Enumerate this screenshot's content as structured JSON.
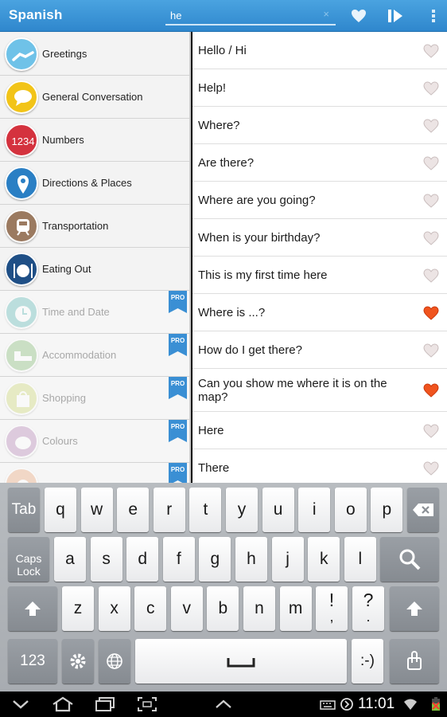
{
  "app": {
    "title": "Spanish"
  },
  "search": {
    "value": "he",
    "clear_glyph": "×"
  },
  "actionbar": {
    "icons": [
      "heart-icon",
      "play-icon",
      "overflow-menu-icon"
    ]
  },
  "categories": [
    {
      "label": "Greetings",
      "icon": "handshake-icon",
      "color": "#6fc2e8",
      "locked": false
    },
    {
      "label": "General Conversation",
      "icon": "speech-bubble-icon",
      "color": "#f2c418",
      "locked": false
    },
    {
      "label": "Numbers",
      "icon": "numbers-icon",
      "color": "#d4323e",
      "locked": false
    },
    {
      "label": "Directions & Places",
      "icon": "map-pin-icon",
      "color": "#2a7fc4",
      "locked": false
    },
    {
      "label": "Transportation",
      "icon": "train-icon",
      "color": "#9b7a60",
      "locked": false
    },
    {
      "label": "Eating Out",
      "icon": "plate-icon",
      "color": "#1f4f86",
      "locked": false
    },
    {
      "label": "Time and Date",
      "icon": "clock-icon",
      "color": "#4fb2b0",
      "locked": true
    },
    {
      "label": "Accommodation",
      "icon": "bed-icon",
      "color": "#79b66a",
      "locked": true
    },
    {
      "label": "Shopping",
      "icon": "shopping-bag-icon",
      "color": "#c9d66a",
      "locked": true
    },
    {
      "label": "Colours",
      "icon": "palette-icon",
      "color": "#b07ab0",
      "locked": true
    },
    {
      "label": "",
      "icon": "category-icon",
      "color": "#e8a070",
      "locked": true
    }
  ],
  "pro_label": "PRO",
  "phrases": [
    {
      "text": "Hello / Hi",
      "favorite": false
    },
    {
      "text": "Help!",
      "favorite": false
    },
    {
      "text": "Where?",
      "favorite": false
    },
    {
      "text": "Are there?",
      "favorite": false
    },
    {
      "text": "Where are you going?",
      "favorite": false
    },
    {
      "text": "When is your birthday?",
      "favorite": false
    },
    {
      "text": "This is my first time here",
      "favorite": false
    },
    {
      "text": "Where is ...?",
      "favorite": true
    },
    {
      "text": "How do I get there?",
      "favorite": false
    },
    {
      "text": "Can you show me where it is on the map?",
      "favorite": true
    },
    {
      "text": "Here",
      "favorite": false
    },
    {
      "text": "There",
      "favorite": false
    }
  ],
  "keyboard": {
    "row1": [
      "Tab",
      "q",
      "w",
      "e",
      "r",
      "t",
      "y",
      "u",
      "i",
      "o",
      "p",
      "backspace"
    ],
    "row2": [
      "Caps Lock",
      "a",
      "s",
      "d",
      "f",
      "g",
      "h",
      "j",
      "k",
      "l",
      "search"
    ],
    "row3": [
      "shift",
      "z",
      "x",
      "c",
      "v",
      "b",
      "n",
      "m",
      "!",
      "?",
      "shift"
    ],
    "row4": [
      "123",
      "settings",
      "language",
      "space",
      ":-)",
      "clipboard"
    ],
    "punct_sub": {
      "!": ",",
      "?": "."
    }
  },
  "system": {
    "time": "11:01"
  },
  "colors": {
    "accent": "#2f87cd",
    "favorite": "#f0541e",
    "heart_off": "#ece4e4"
  }
}
